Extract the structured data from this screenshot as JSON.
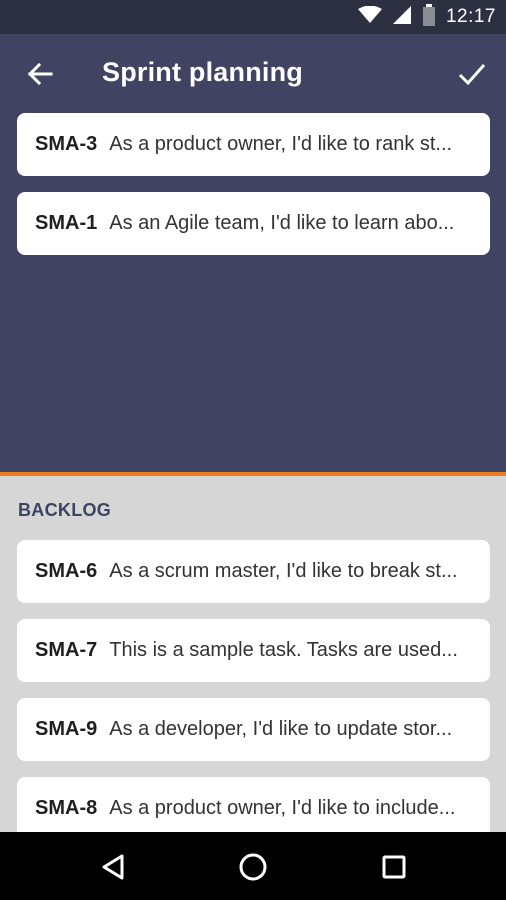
{
  "status_bar": {
    "time": "12:17",
    "icons": [
      "wifi-icon",
      "signal-icon",
      "battery-icon"
    ]
  },
  "toolbar": {
    "title": "Sprint planning",
    "back_icon": "arrow-left-icon",
    "confirm_icon": "check-icon"
  },
  "sprint": {
    "issues": [
      {
        "key": "SMA-3",
        "summary": "As a product owner, I'd like to rank st..."
      },
      {
        "key": "SMA-1",
        "summary": "As an Agile team, I'd like to learn abo..."
      }
    ]
  },
  "backlog": {
    "header": "BACKLOG",
    "issues": [
      {
        "key": "SMA-6",
        "summary": "As a scrum master, I'd like to break st..."
      },
      {
        "key": "SMA-7",
        "summary": "This is a sample task. Tasks are used..."
      },
      {
        "key": "SMA-9",
        "summary": "As a developer, I'd like to update stor..."
      },
      {
        "key": "SMA-8",
        "summary": "As a product owner, I'd like to include..."
      }
    ]
  },
  "nav_bar": {
    "icons": [
      "back-triangle-icon",
      "home-circle-icon",
      "recents-square-icon"
    ]
  },
  "colors": {
    "header_bg": "#404462",
    "status_bg": "#2c3040",
    "accent": "#ee7b24",
    "backlog_bg": "#d6d6d6",
    "backlog_header": "#3d4463"
  }
}
